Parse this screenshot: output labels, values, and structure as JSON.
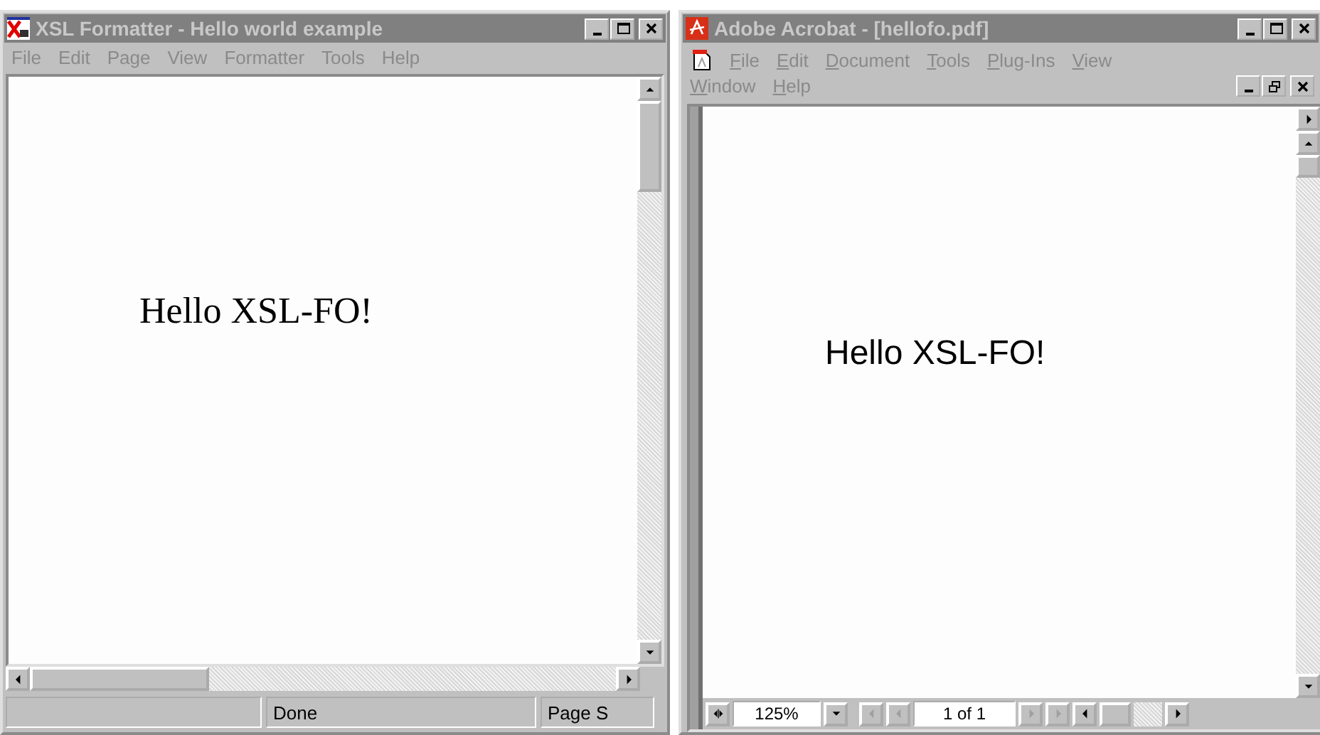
{
  "formatter_window": {
    "title": "XSL Formatter - Hello world example",
    "menu": [
      "File",
      "Edit",
      "Page",
      "View",
      "Formatter",
      "Tools",
      "Help"
    ],
    "document_text": "Hello XSL-FO!",
    "status_bar": [
      "Done",
      "Page S"
    ]
  },
  "acrobat_window": {
    "title": "Adobe Acrobat - [hellofo.pdf]",
    "menu": [
      "File",
      "Edit",
      "Document",
      "Tools",
      "Plug-Ins",
      "View",
      "Window",
      "Help"
    ],
    "document_text": "Hello XSL-FO!",
    "zoom": "125%",
    "page": "1 of 1"
  }
}
